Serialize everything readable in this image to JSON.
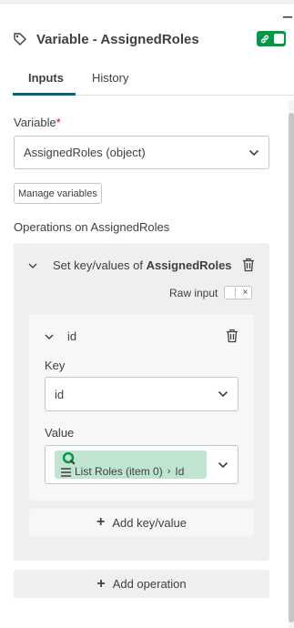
{
  "header": {
    "title": "Variable - AssignedRoles"
  },
  "tabs": [
    {
      "label": "Inputs",
      "active": true
    },
    {
      "label": "History",
      "active": false
    }
  ],
  "variable": {
    "label": "Variable",
    "required_mark": "*",
    "selected_value": "AssignedRoles (object)"
  },
  "manage_variables_label": "Manage variables",
  "operations_label": "Operations on AssignedRoles",
  "operation": {
    "title_prefix": "Set key/values of",
    "title_target": "AssignedRoles",
    "raw_input_label": "Raw input",
    "raw_input_off_mark": "×"
  },
  "kv_item": {
    "name": "id",
    "key_label": "Key",
    "key_value": "id",
    "value_label": "Value",
    "value_token": {
      "source": "List Roles (item 0)",
      "separator": "›",
      "field": "Id"
    }
  },
  "add_key_value_label": "Add key/value",
  "add_operation_label": "Add operation",
  "colors": {
    "accent_green": "#009845",
    "tab_underline": "#006580",
    "token_bg": "#bfe4cf",
    "qlik_green": "#009845"
  }
}
